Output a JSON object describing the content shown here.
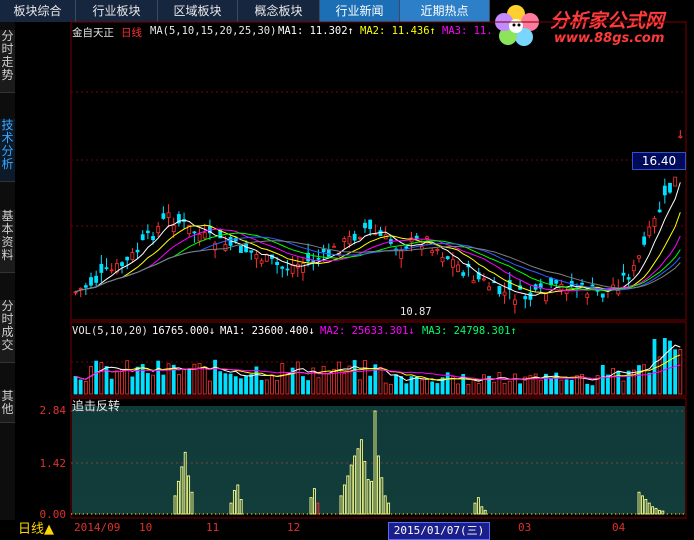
{
  "tabs": [
    {
      "label": "板块综合",
      "active": false
    },
    {
      "label": "行业板块",
      "active": false
    },
    {
      "label": "区域板块",
      "active": false
    },
    {
      "label": "概念板块",
      "active": false
    },
    {
      "label": "行业新闻",
      "active": true
    },
    {
      "label": "近期热点",
      "active": true
    }
  ],
  "logo": {
    "name": "分析家公式网",
    "url": "www.88gs.com"
  },
  "sidebar": [
    {
      "label": "分时走势",
      "active": false
    },
    {
      "label": "技术分析",
      "active": true
    },
    {
      "label": "基本资料",
      "active": false
    },
    {
      "label": "分时成交",
      "active": false
    },
    {
      "label": "其他",
      "active": false
    }
  ],
  "main": {
    "stock": "金自天正",
    "period": "日线",
    "ma_label": "MA(5,10,15,20,25,30)",
    "ma1": "MA1: 11.302↑",
    "ma2": "MA2: 11.436↑",
    "ma3": "MA3: 11.",
    "current_price": "16.40",
    "low_mark": "10.87"
  },
  "vol": {
    "label": "VOL(5,10,20)",
    "value": "16765.000↓",
    "ma1": "MA1: 23600.400↓",
    "ma2": "MA2: 25633.301↓",
    "ma3": "MA3: 24798.301↑"
  },
  "indicator": {
    "name": "追击反转",
    "ticks": [
      "2.84",
      "1.42",
      "0.00"
    ]
  },
  "bottom": {
    "period_button": "日线",
    "date_ticks": [
      "2014/09",
      "10",
      "11",
      "12",
      "2015/01/07(三)",
      "03",
      "04"
    ]
  },
  "colors": {
    "up": "#ff3030",
    "down": "#00e0ff",
    "grid": "#7a0000",
    "ma1": "#ffffff",
    "ma2": "#ffff00",
    "ma3": "#ff00ff",
    "ma4": "#00ff00",
    "ma5": "#3060ff",
    "ma6": "#808080"
  },
  "chart_data": [
    {
      "type": "candlestick",
      "title": "金自天正 日线",
      "series": [
        {
          "name": "MA1",
          "value": 11.302
        },
        {
          "name": "MA2",
          "value": 11.436
        }
      ],
      "price_range": [
        10.87,
        16.4
      ]
    },
    {
      "type": "bar",
      "title": "VOL(5,10,20)",
      "last_value": 16765.0,
      "series": [
        {
          "name": "MA1",
          "value": 23600.4
        },
        {
          "name": "MA2",
          "value": 25633.301
        },
        {
          "name": "MA3",
          "value": 24798.301
        }
      ]
    },
    {
      "type": "bar",
      "title": "追击反转",
      "ylim": [
        0,
        2.84
      ],
      "yticks": [
        0,
        1.42,
        2.84
      ],
      "values": [
        0.5,
        0.9,
        1.3,
        1.7,
        1.05,
        0.6,
        0.3,
        0.4,
        0.2,
        0.65,
        0.8,
        0.4,
        0.25,
        0.15,
        0.7,
        0.45,
        0.3,
        0.5,
        0.8,
        1.05,
        1.35,
        1.6,
        1.8,
        2.05,
        1.45,
        0.95,
        0.9,
        2.84,
        1.6,
        1.0,
        0.5,
        0.3,
        0.4,
        0.3,
        0.2,
        0.1,
        0.45,
        0.3,
        0.15,
        0.1,
        0.6,
        0.5,
        0.4,
        0.3,
        0.2,
        0.1
      ]
    }
  ]
}
